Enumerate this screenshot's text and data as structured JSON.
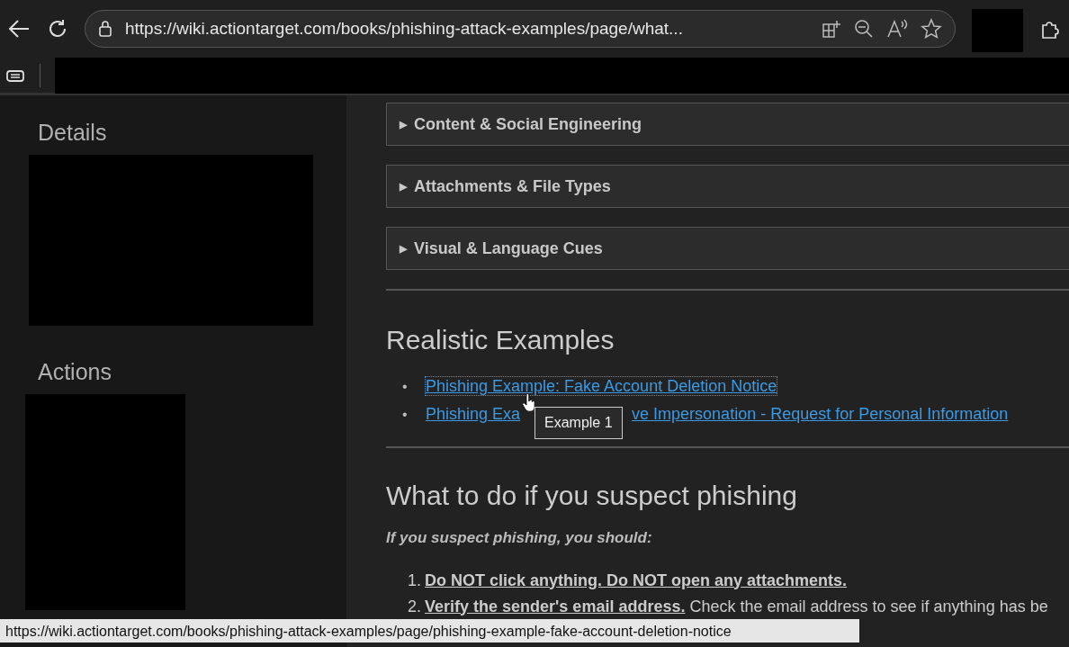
{
  "browser": {
    "url": "https://wiki.actiontarget.com/books/phishing-attack-examples/page/what..."
  },
  "sidebar": {
    "sections": [
      {
        "title": "Details"
      },
      {
        "title": "Actions"
      }
    ]
  },
  "accordions": [
    {
      "marker": "▶",
      "label": "Content & Social Engineering",
      "expanded": false
    },
    {
      "marker": "▶",
      "label": "Attachments & File Types",
      "expanded": false
    },
    {
      "marker": "▶",
      "label": "Visual & Language Cues",
      "expanded": false
    }
  ],
  "examples": {
    "heading": "Realistic Examples",
    "links": [
      {
        "bullet": "•",
        "text_start": "Phishing Example: Fake Account Deletion Notice",
        "hovered": true
      },
      {
        "bullet": "•",
        "text_start": "Phishing Exa",
        "text_end": "ve Impersonation - Request for Personal Information",
        "hovered": false
      }
    ]
  },
  "tooltip": "Example 1",
  "suspect": {
    "heading": "What to do if you suspect phishing",
    "intro": "If you suspect phishing, you should:",
    "steps": [
      {
        "number": "1.",
        "bold": "Do NOT click anything. Do NOT open any attachments."
      },
      {
        "number": "2.",
        "bold": "Verify the sender's email address.",
        "rest": "Check the email address to see if anything has be"
      }
    ]
  },
  "status_bar": "https://wiki.actiontarget.com/books/phishing-attack-examples/page/phishing-example-fake-account-deletion-notice"
}
